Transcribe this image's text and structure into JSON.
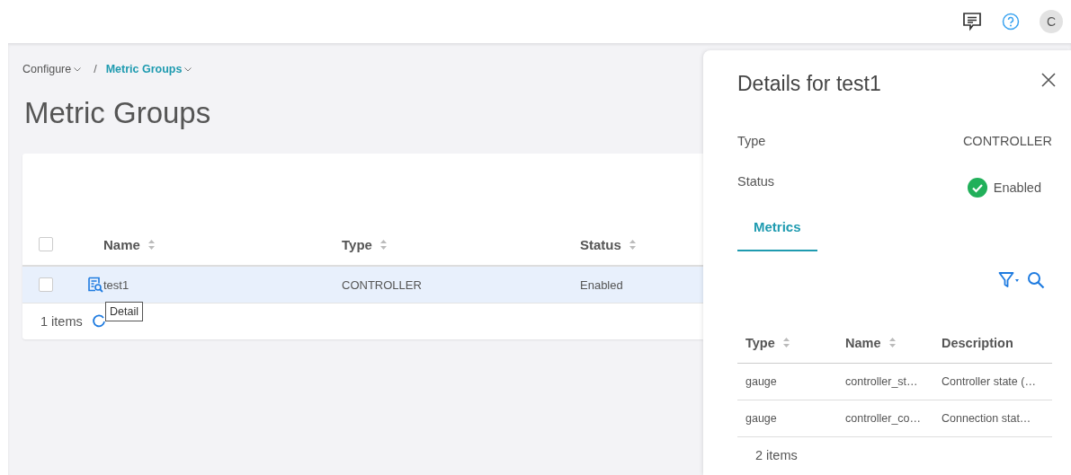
{
  "topbar": {
    "avatar": "C"
  },
  "breadcrumb": [
    {
      "label": "Configure",
      "selected": false
    },
    {
      "label": "Metric Groups",
      "selected": true
    }
  ],
  "breadcrumb_separator": "/",
  "title": "Metric Groups",
  "table": {
    "select_all_checked": false,
    "columns": [
      {
        "label": "Name",
        "sortable": true
      },
      {
        "label": "Type",
        "sortable": true
      },
      {
        "label": "Status",
        "sortable": true
      }
    ],
    "rows": [
      {
        "name": "test1",
        "type": "CONTROLLER",
        "status": "Enabled",
        "checked": false,
        "selected": true
      }
    ],
    "footer": "1 items"
  },
  "tooltip": "Detail",
  "details": {
    "title": "Details for test1",
    "fields": [
      {
        "label": "Type",
        "value": "CONTROLLER",
        "kind": "text"
      },
      {
        "label": "Status",
        "value": "Enabled",
        "kind": "status"
      }
    ],
    "tabs": [
      {
        "label": "Metrics",
        "selected": true
      }
    ],
    "columns": [
      {
        "label": "Type",
        "sortable": true
      },
      {
        "label": "Name",
        "sortable": true
      },
      {
        "label": "Description",
        "sortable": false
      }
    ],
    "rows": [
      [
        "gauge",
        "controller_st…",
        "Controller state (…"
      ],
      [
        "gauge",
        "controller_co…",
        "Connection stat…"
      ]
    ],
    "footer": "2 items"
  }
}
